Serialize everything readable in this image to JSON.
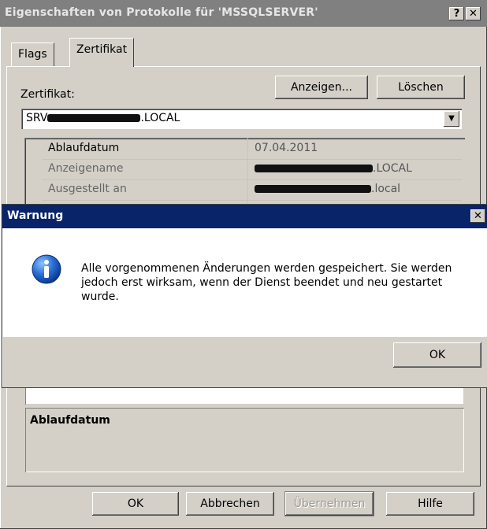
{
  "window": {
    "title": "Eigenschaften von Protokolle für 'MSSQLSERVER'",
    "help_button": "?",
    "close_button": "✕"
  },
  "tabs": [
    {
      "label": "Flags"
    },
    {
      "label": "Zertifikat"
    }
  ],
  "certificate": {
    "label": "Zertifikat:",
    "view_button": "Anzeigen...",
    "delete_button": "Löschen",
    "selected_prefix": "SRV",
    "selected_suffix": ".LOCAL"
  },
  "grid": {
    "rows": [
      {
        "key": "Ablaufdatum",
        "value_prefix": "",
        "value": "07.04.2011"
      },
      {
        "key": "Anzeigename",
        "value_prefix": "",
        "value": ".LOCAL"
      },
      {
        "key": "Ausgestellt an",
        "value_prefix": "",
        "value": ".local"
      }
    ]
  },
  "description": {
    "title": "Ablaufdatum"
  },
  "footer": {
    "ok": "OK",
    "cancel": "Abbrechen",
    "apply": "Übernehmen",
    "help": "Hilfe"
  },
  "dialog": {
    "title": "Warnung",
    "close": "✕",
    "message": "Alle vorgenommenen Änderungen werden gespeichert. Sie werden jedoch erst wirksam, wenn der Dienst beendet und neu gestartet wurde.",
    "ok": "OK",
    "icon": "info-icon"
  }
}
